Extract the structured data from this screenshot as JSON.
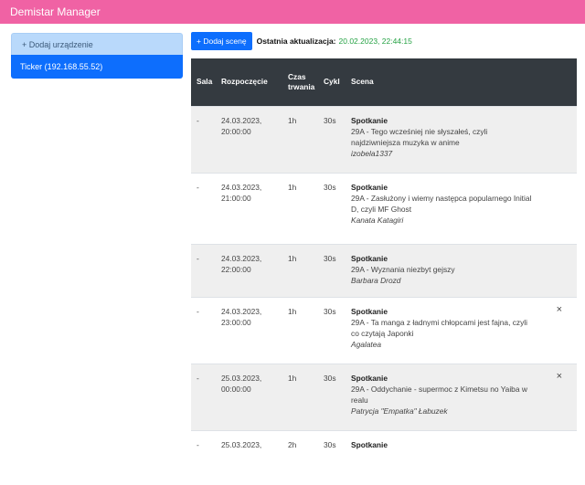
{
  "app": {
    "title": "Demistar Manager"
  },
  "sidebar": {
    "add_label": "+ Dodaj urządzenie",
    "devices": [
      {
        "label": "Ticker (192.168.55.52)"
      }
    ]
  },
  "toolbar": {
    "add_scene_label": "+ Dodaj scenę",
    "last_update_label": "Ostatnia aktualizacja:",
    "last_update_value": "20.02.2023, 22:44:15"
  },
  "table": {
    "headers": {
      "room": "Sala",
      "start": "Rozpoczęcie",
      "duration_1": "Czas",
      "duration_2": "trwania",
      "cycle": "Cykl",
      "scene": "Scena"
    },
    "rows": [
      {
        "room": "-",
        "start_date": "24.03.2023,",
        "start_time": "20:00:00",
        "duration": "1h",
        "cycle": "30s",
        "scene_title": "Spotkanie",
        "scene_text": "29A - Tego wcześniej nie słyszałeś, czyli najdziwniejsza muzyka w anime",
        "scene_author": "izobela1337",
        "delete_icon": ""
      },
      {
        "room": "-",
        "start_date": "24.03.2023,",
        "start_time": "21:00:00",
        "duration": "1h",
        "cycle": "30s",
        "scene_title": "Spotkanie",
        "scene_text": "29A - Zasłużony i wiemy następca popularnego Initial D, czyli MF Ghost",
        "scene_author": "Kanata Katagiri",
        "delete_icon": ""
      },
      {
        "room": "-",
        "start_date": "24.03.2023,",
        "start_time": "22:00:00",
        "duration": "1h",
        "cycle": "30s",
        "scene_title": "Spotkanie",
        "scene_text": "29A - Wyznania niezbyt gejszy",
        "scene_author": "Barbara Drozd",
        "delete_icon": ""
      },
      {
        "room": "-",
        "start_date": "24.03.2023,",
        "start_time": "23:00:00",
        "duration": "1h",
        "cycle": "30s",
        "scene_title": "Spotkanie",
        "scene_text": "29A - Ta manga z ładnymi chłopcami jest fajna, czyli co czytają Japonki",
        "scene_author": "Agalatea",
        "delete_icon": "×"
      },
      {
        "room": "-",
        "start_date": "25.03.2023,",
        "start_time": "00:00:00",
        "duration": "1h",
        "cycle": "30s",
        "scene_title": "Spotkanie",
        "scene_text": "29A - Oddychanie - supermoc z Kimetsu no Yaiba w realu",
        "scene_author": "Patrycja \"Empatka\" Łabuzek",
        "delete_icon": "×"
      },
      {
        "room": "-",
        "start_date": "25.03.2023,",
        "start_time": "",
        "duration": "2h",
        "cycle": "30s",
        "scene_title": "Spotkanie",
        "scene_text": "",
        "scene_author": "",
        "delete_icon": ""
      }
    ]
  }
}
